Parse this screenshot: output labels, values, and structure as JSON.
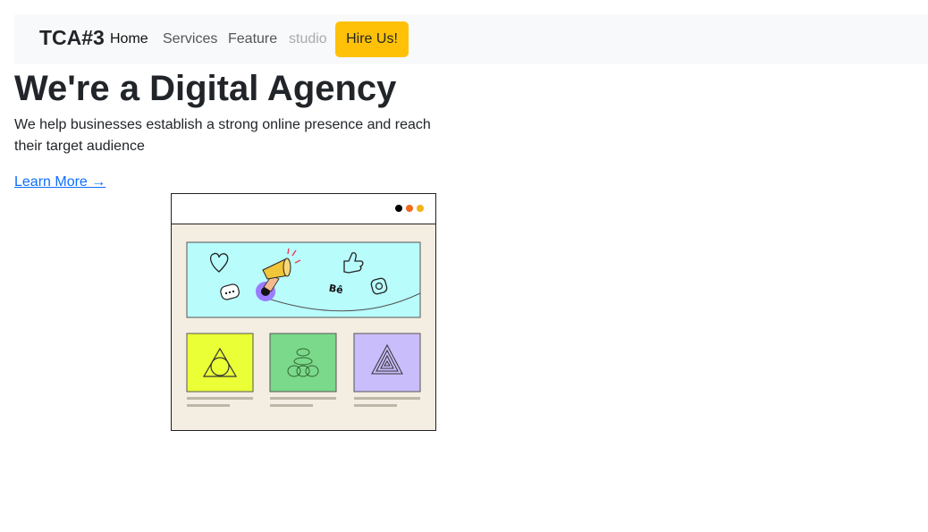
{
  "navbar": {
    "brand": "TCA#3",
    "links": [
      {
        "label": "Home"
      },
      {
        "label": "Services"
      },
      {
        "label": "Feature"
      },
      {
        "label": "studio"
      }
    ],
    "cta_label": "Hire Us!"
  },
  "hero": {
    "title": "We're a Digital Agency",
    "subtitle": "We help businesses establish a strong online presence and reach their target audience",
    "link_label": "Learn More →",
    "illustration": {
      "window_dots": [
        "#000000",
        "#f06a1d",
        "#f5b316"
      ],
      "banner_color": "#b8fcfc",
      "banner_text": "Bê",
      "card_colors": [
        "#eaff36",
        "#7ad98a",
        "#c9bdfc"
      ],
      "frame_color": "#f3ede2",
      "icons": [
        "heart-icon",
        "chat-icon",
        "megaphone-icon",
        "thumbs-up-icon",
        "behance-icon",
        "instagram-icon",
        "triangle-circle-icon",
        "stacked-shapes-icon",
        "nested-triangle-icon"
      ]
    }
  },
  "colors": {
    "navbar_bg": "#f8f9fa",
    "cta_bg": "#ffc107",
    "link": "#0d6efd",
    "text": "#212529"
  }
}
